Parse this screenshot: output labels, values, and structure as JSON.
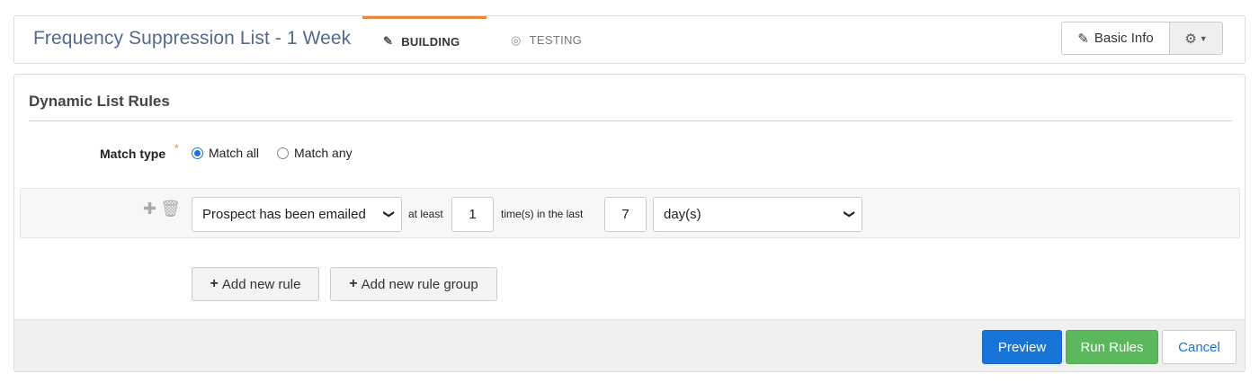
{
  "header": {
    "title": "Frequency Suppression List - 1 Week",
    "tabs": [
      {
        "label": "BUILDING",
        "active": true,
        "icon": "edit-icon"
      },
      {
        "label": "TESTING",
        "active": false,
        "icon": "target-icon"
      }
    ],
    "basic_info_label": "Basic Info",
    "accent_color": "#e8873b"
  },
  "section": {
    "title": "Dynamic List Rules"
  },
  "match": {
    "label": "Match type",
    "required_marker": "*",
    "options": [
      {
        "label": "Match all",
        "selected": true
      },
      {
        "label": "Match any",
        "selected": false
      }
    ]
  },
  "rule": {
    "condition": "Prospect has been emailed",
    "at_least_label": "at least",
    "times_value": "1",
    "times_label": "time(s) in the last",
    "period_value": "7",
    "unit": "day(s)"
  },
  "actions": {
    "add_rule": "Add new rule",
    "add_rule_group": "Add new rule group",
    "preview": "Preview",
    "run_rules": "Run Rules",
    "cancel": "Cancel"
  },
  "colors": {
    "primary": "#1874d6",
    "success": "#5cb85c"
  }
}
